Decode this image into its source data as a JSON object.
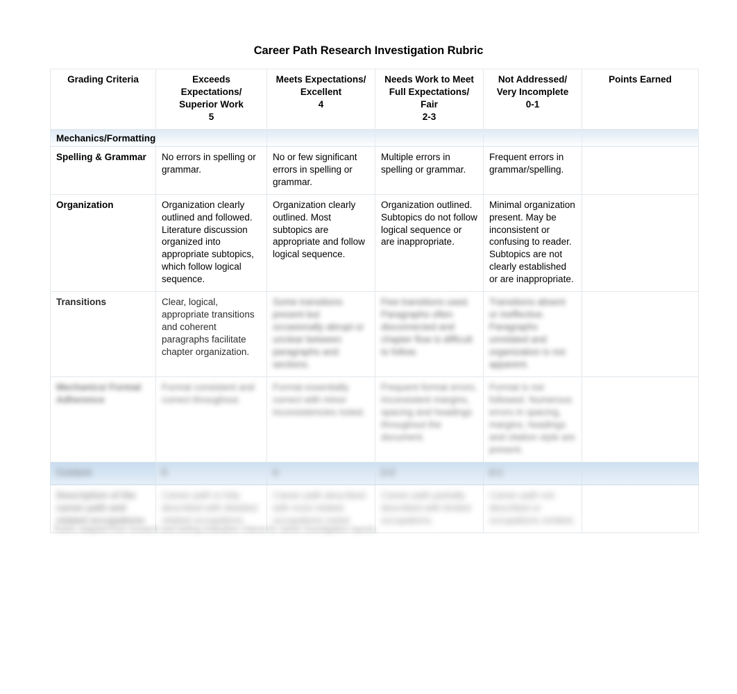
{
  "document": {
    "title": "Career Path Research Investigation Rubric"
  },
  "table": {
    "headers": [
      {
        "lines": [
          "Grading Criteria"
        ]
      },
      {
        "lines": [
          "Exceeds Expectations/",
          "Superior Work",
          "5"
        ]
      },
      {
        "lines": [
          "Meets Expectations/",
          "Excellent",
          "4"
        ]
      },
      {
        "lines": [
          "Needs Work to Meet",
          "Full Expectations/ Fair",
          "2-3"
        ]
      },
      {
        "lines": [
          "Not Addressed/",
          "Very Incomplete",
          "0-1"
        ]
      },
      {
        "lines": [
          "Points Earned"
        ]
      }
    ],
    "section_label": "Mechanics/Formatting",
    "rows": [
      {
        "criteria": "Spelling & Grammar",
        "exceeds": "No errors in spelling or grammar.",
        "meets": "No or few significant errors in spelling or grammar.",
        "needs": "Multiple errors in spelling or grammar.",
        "not_addressed": "Frequent errors in grammar/spelling.",
        "points": ""
      },
      {
        "criteria": "Organization",
        "exceeds": "Organization clearly outlined and followed. Literature discussion organized into appropriate subtopics, which follow logical sequence.",
        "meets": "Organization clearly outlined.  Most subtopics are appropriate and follow logical sequence.",
        "needs": "Organization outlined. Subtopics do not follow logical sequence or are inappropriate.",
        "not_addressed": "Minimal organization present. May be inconsistent or confusing to reader. Subtopics are not clearly established or are inappropriate.",
        "points": ""
      },
      {
        "criteria": "Transitions",
        "exceeds": "Clear, logical, appropriate transitions and coherent paragraphs facilitate chapter organization.",
        "meets": "Some transitions present but occasionally abrupt or unclear between paragraphs and sections.",
        "needs": "Few transitions used. Paragraphs often disconnected and chapter flow is difficult to follow.",
        "not_addressed": "Transitions absent or ineffective. Paragraphs unrelated and organization is not apparent.",
        "points": ""
      },
      {
        "criteria": "Mechanics/ Format Adherence",
        "exceeds": "Format consistent and correct throughout.",
        "meets": "Format essentially correct with minor inconsistencies noted.",
        "needs": "Frequent format errors. Inconsistent margins, spacing and headings throughout the document.",
        "not_addressed": "Format is not followed. Numerous errors in spacing, margins, headings and citation style are present.",
        "points": ""
      }
    ],
    "scale_row": {
      "criteria": "Content",
      "exceeds": "5",
      "meets": "4",
      "needs": "2-3",
      "not_addressed": "0-1",
      "points": ""
    },
    "final_row": {
      "criteria": "Description of the career path and related occupations",
      "exceeds": "Career path is fully described with detailed related occupations.",
      "meets": "Career path described with most related occupations noted.",
      "needs": "Career path partially described with limited occupations.",
      "not_addressed": "Career path not described or occupations omitted.",
      "points": ""
    },
    "footnote": "Rubric adapted from research and writing evaluation criteria for career investigation reports."
  }
}
